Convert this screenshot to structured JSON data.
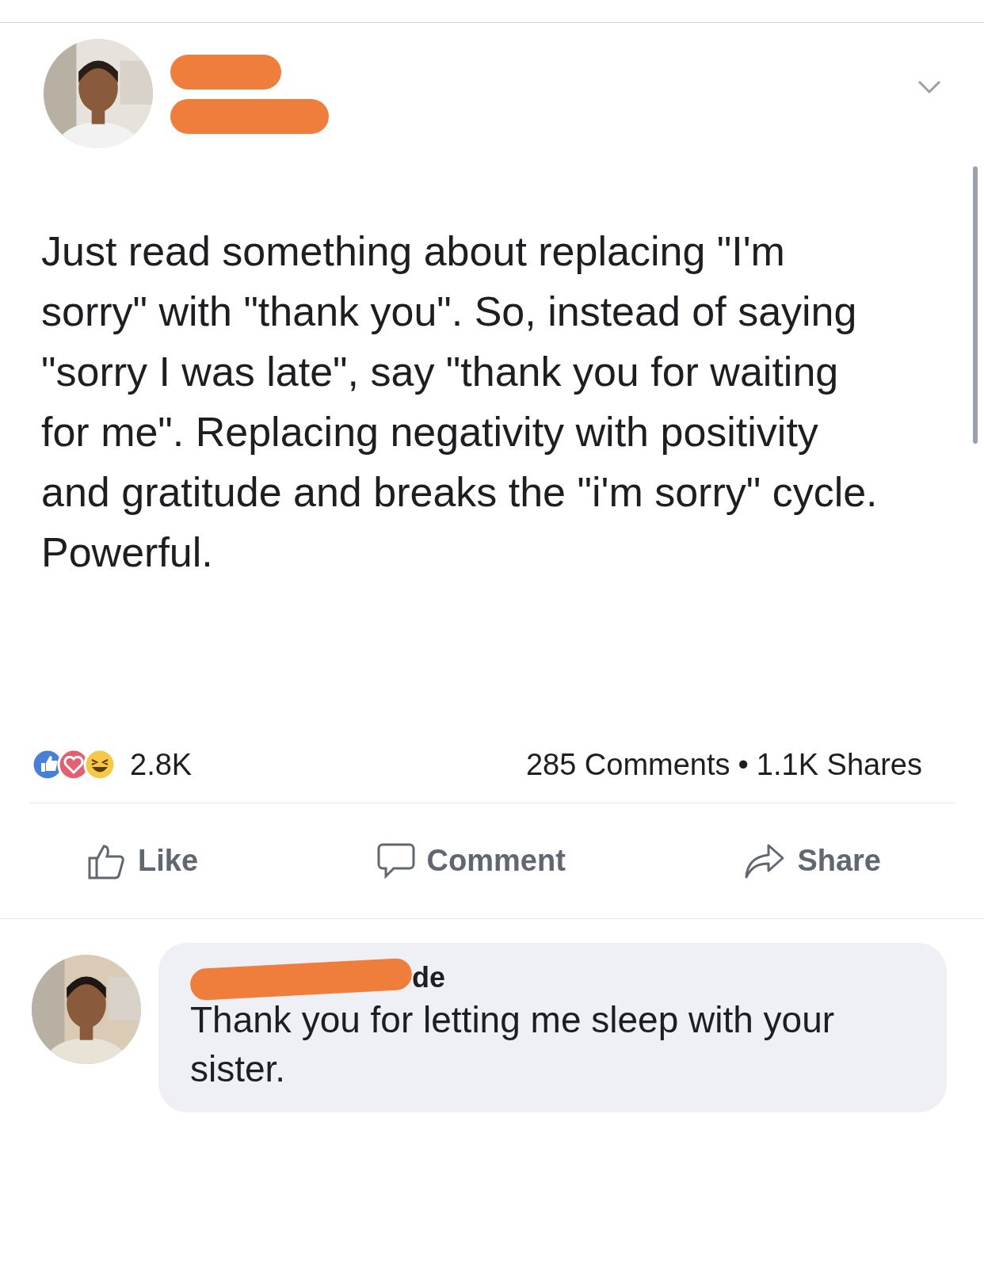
{
  "post": {
    "text": "Just read something about replacing \"I'm sorry\" with \"thank you\". So, instead of saying \"sorry I was late\", say \"thank you for waiting for me\". Replacing negativity with positivity and gratitude and breaks the \"i'm sorry\" cycle. Powerful.",
    "reactions": {
      "count": "2.8K"
    },
    "comments_count": "285 Comments",
    "separator": "•",
    "shares_count": "1.1K Shares"
  },
  "actions": [
    {
      "kind": "like",
      "label": "Like"
    },
    {
      "kind": "comment",
      "label": "Comment"
    },
    {
      "kind": "share",
      "label": "Share"
    }
  ],
  "comment": {
    "author_visible": "de",
    "text": "Thank you for letting me sleep with your sister."
  }
}
